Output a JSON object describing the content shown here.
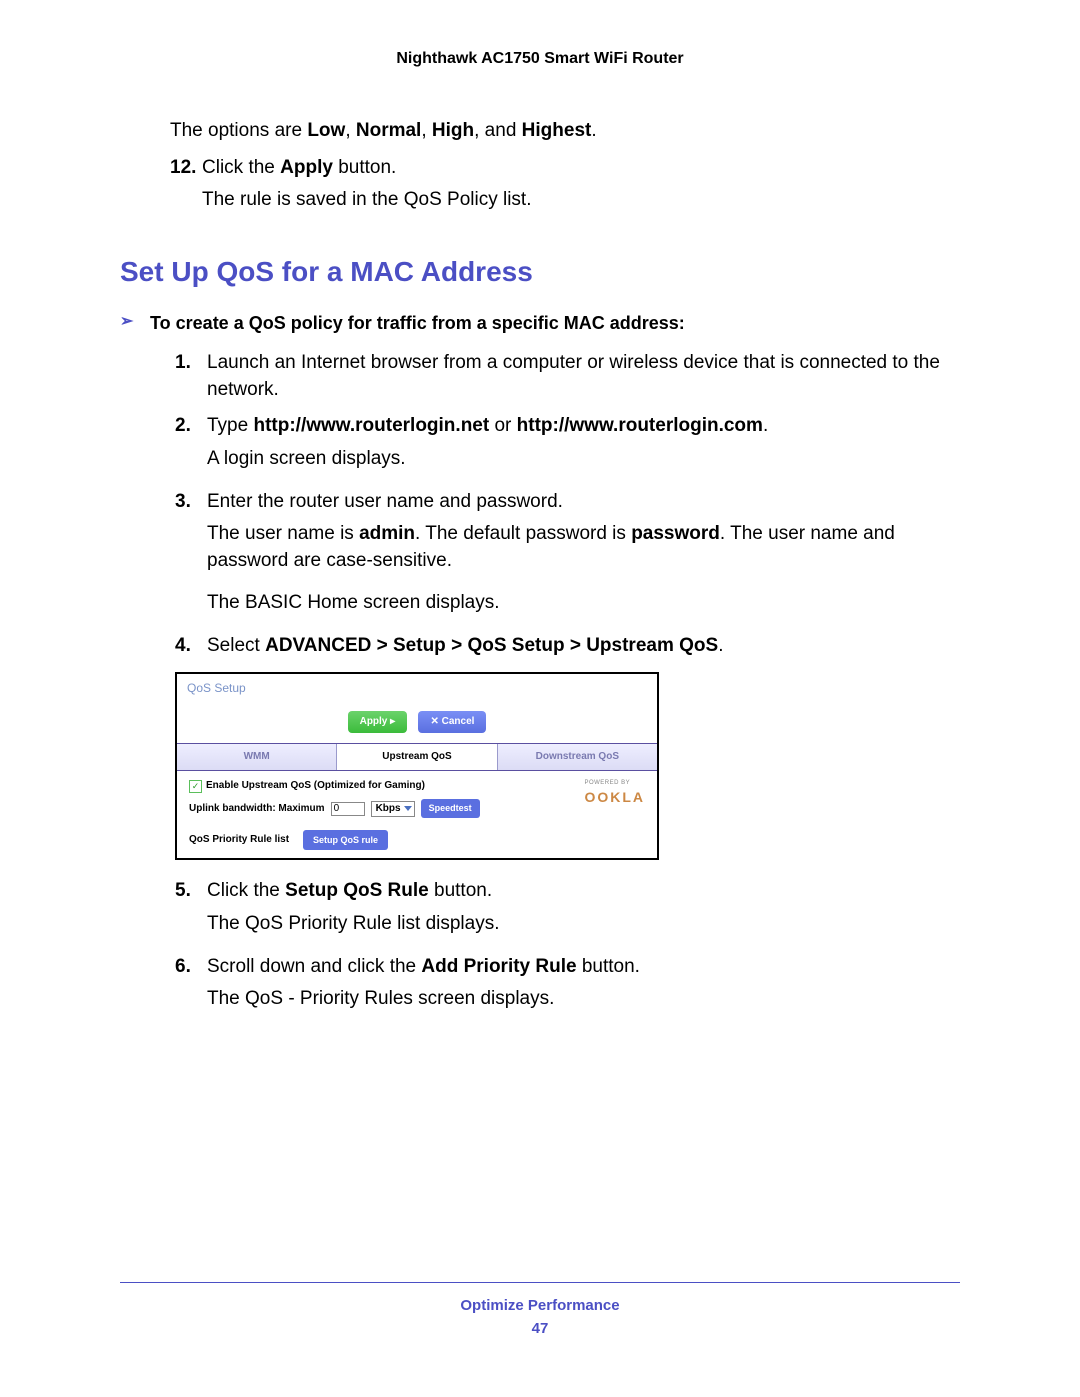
{
  "doc_title": "Nighthawk AC1750 Smart WiFi Router",
  "intro": {
    "options_prefix": "The options are ",
    "opt_low": "Low",
    "opt_normal": "Normal",
    "opt_high": "High",
    "opt_highest": "Highest",
    "step12_num": "12.",
    "step12_a": "Click the ",
    "step12_b": "Apply",
    "step12_c": " button.",
    "step12_sub": "The rule is saved in the QoS Policy list."
  },
  "section_heading": "Set Up QoS for a MAC Address",
  "arrow_text": "To create a QoS policy for traffic from a specific MAC address:",
  "steps": {
    "s1_num": "1.",
    "s1": "Launch an Internet browser from a computer or wireless device that is connected to the network.",
    "s2_num": "2.",
    "s2_a": "Type ",
    "s2_b": "http://www.routerlogin.net",
    "s2_c": " or ",
    "s2_d": "http://www.routerlogin.com",
    "s2_e": ".",
    "s2_sub": "A login screen displays.",
    "s3_num": "3.",
    "s3": "Enter the router user name and password.",
    "s3_sub_a": "The user name is ",
    "s3_sub_b": "admin",
    "s3_sub_c": ". The default password is ",
    "s3_sub_d": "password",
    "s3_sub_e": ". The user name and password are case-sensitive.",
    "s3_sub2": "The BASIC Home screen displays.",
    "s4_num": "4.",
    "s4_a": "Select ",
    "s4_b": "ADVANCED > Setup > QoS Setup > Upstream QoS",
    "s4_c": ".",
    "s5_num": "5.",
    "s5_a": "Click the ",
    "s5_b": "Setup QoS Rule",
    "s5_c": " button.",
    "s5_sub": "The QoS Priority Rule list displays.",
    "s6_num": "6.",
    "s6_a": "Scroll down and click the ",
    "s6_b": "Add Priority Rule",
    "s6_c": " button.",
    "s6_sub": "The QoS - Priority Rules screen displays."
  },
  "qos": {
    "title": "QoS Setup",
    "apply_btn": "Apply ▸",
    "cancel_btn": "✕ Cancel",
    "tab_wmm": "WMM",
    "tab_up": "Upstream QoS",
    "tab_down": "Downstream QoS",
    "enable_label": "Enable Upstream QoS (Optimized for Gaming)",
    "uplink_label": "Uplink bandwidth: Maximum",
    "uplink_value": "0",
    "uplink_unit": "Kbps",
    "speedtest": "Speedtest",
    "powered": "POWERED BY",
    "ookla": "OOKLA",
    "rule_label": "QoS Priority Rule list",
    "setup_rule": "Setup QoS rule"
  },
  "footer": {
    "text": "Optimize Performance",
    "page": "47"
  }
}
